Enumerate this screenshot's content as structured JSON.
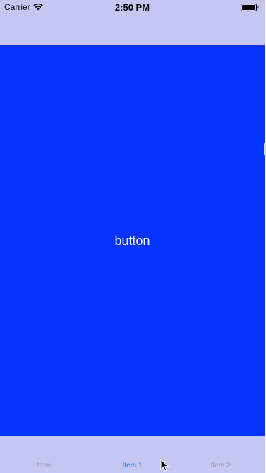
{
  "status_bar": {
    "carrier": "Carrier",
    "time": "2:50 PM",
    "wifi_icon": "wifi-icon",
    "battery_icon": "battery-icon"
  },
  "main": {
    "button_label": "button",
    "background_color": "#0433ff"
  },
  "tab_bar": {
    "items": [
      {
        "label": "Item",
        "selected": false
      },
      {
        "label": "Item 1",
        "selected": true
      },
      {
        "label": "Item 2",
        "selected": false
      }
    ],
    "selected_color": "#1a7cf4",
    "bar_color": "#c6c6f2"
  }
}
